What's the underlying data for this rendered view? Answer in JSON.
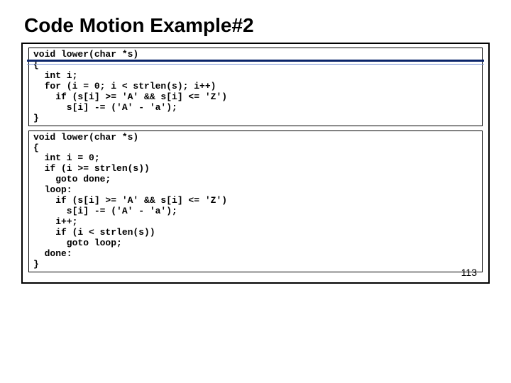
{
  "title": "Code Motion Example#2",
  "code1": "void lower(char *s)\n{\n  int i;\n  for (i = 0; i < strlen(s); i++)\n    if (s[i] >= 'A' && s[i] <= 'Z')\n      s[i] -= ('A' - 'a');\n}",
  "code2": "void lower(char *s)\n{\n  int i = 0;\n  if (i >= strlen(s))\n    goto done;\n  loop:\n    if (s[i] >= 'A' && s[i] <= 'Z')\n      s[i] -= ('A' - 'a');\n    i++;\n    if (i < strlen(s))\n      goto loop;\n  done:\n}",
  "page_number": "113"
}
